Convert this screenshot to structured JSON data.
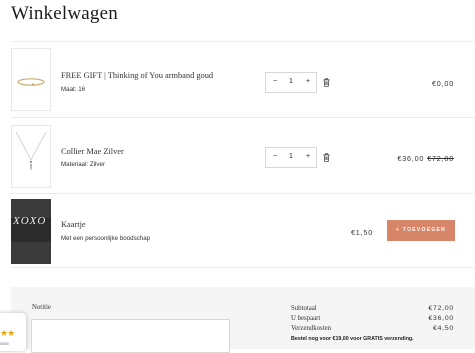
{
  "page": {
    "title": "Winkelwagen"
  },
  "items": [
    {
      "name": "FREE GIFT | Thinking of You armband goud",
      "variant": "Maat: 16",
      "quantity": "1",
      "price": "€0,00"
    },
    {
      "name": "Collier Mae Zilver",
      "variant": "Materiaal: Zilver",
      "quantity": "1",
      "price": "€36,00",
      "old_price": "€72,00"
    },
    {
      "name": "Kaartje",
      "variant": "Met een persoonlijke boodschap",
      "price": "€1,50",
      "add_label": "+ TOEVOEGEN",
      "thumb_text": "XOXO"
    }
  ],
  "qty_controls": {
    "minus": "−",
    "plus": "+"
  },
  "notes": {
    "label": "Notitie"
  },
  "summary": {
    "subtotal_label": "Subtotaal",
    "subtotal": "€72,00",
    "saved_label": "U bespaart",
    "saved": "€36,00",
    "shipping_label": "Verzendkosten",
    "shipping": "€4,50",
    "free_shipping_note": "Bestel nog voor €19,00 voor GRATIS verzending."
  },
  "review_widget": {
    "rating_text": "★★",
    "caption": "0850"
  },
  "colors": {
    "accent": "#d8866a",
    "panel": "#f5f5f5",
    "star": "#e8a614"
  }
}
